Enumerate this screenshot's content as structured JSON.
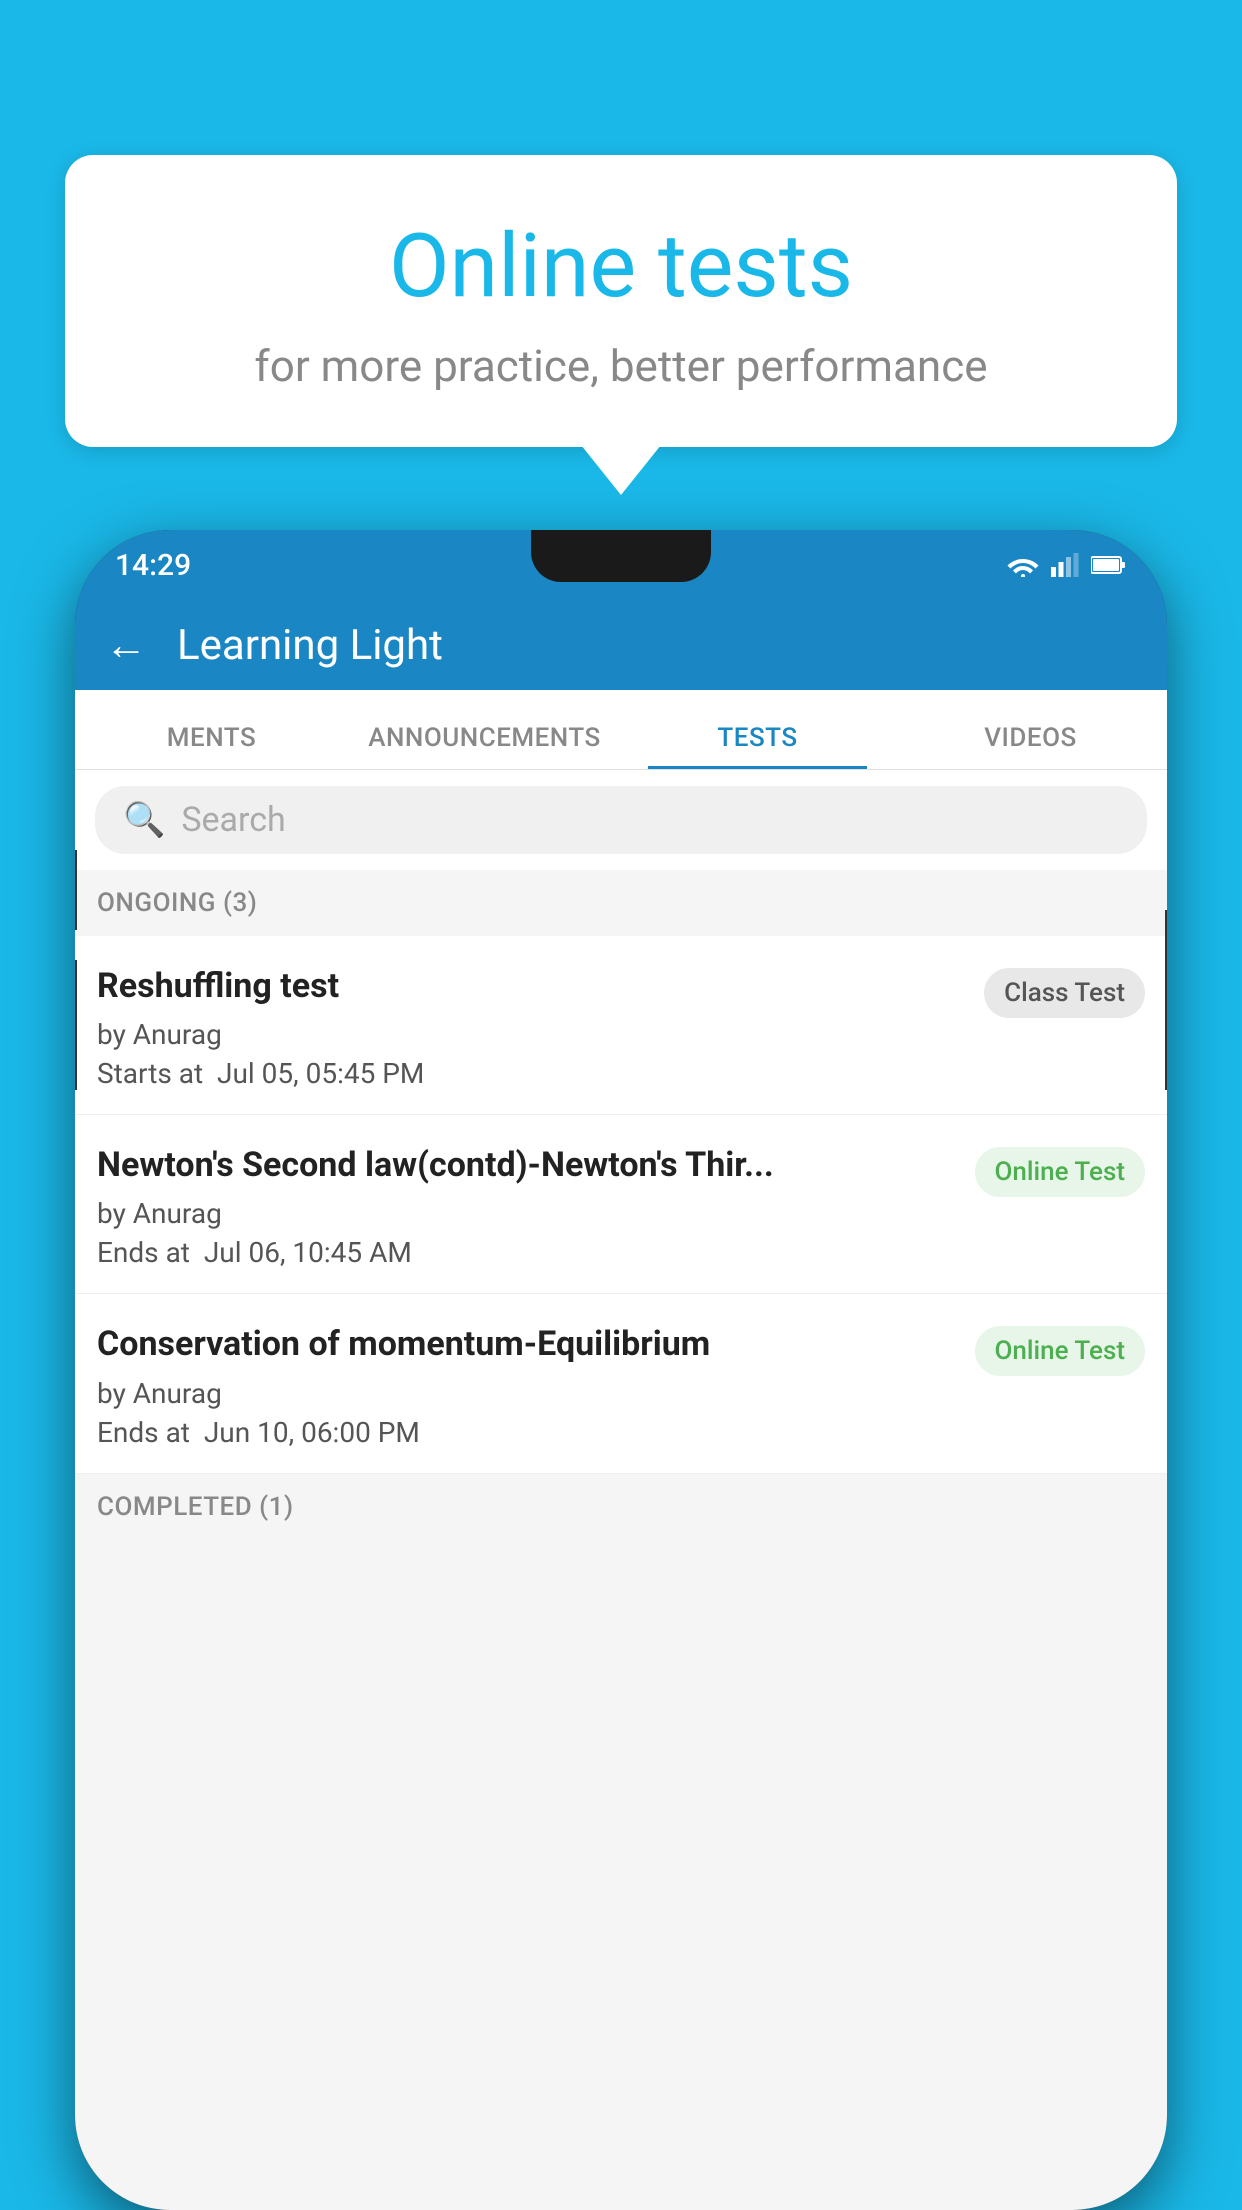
{
  "background": {
    "color": "#1ab8e8"
  },
  "speech_bubble": {
    "title": "Online tests",
    "subtitle": "for more practice, better performance"
  },
  "phone": {
    "status_bar": {
      "time": "14:29"
    },
    "header": {
      "title": "Learning Light",
      "back_label": "←"
    },
    "tabs": [
      {
        "label": "MENTS",
        "active": false
      },
      {
        "label": "ANNOUNCEMENTS",
        "active": false
      },
      {
        "label": "TESTS",
        "active": true
      },
      {
        "label": "VIDEOS",
        "active": false
      }
    ],
    "search": {
      "placeholder": "Search"
    },
    "sections": [
      {
        "header": "ONGOING (3)",
        "tests": [
          {
            "name": "Reshuffling test",
            "author": "by Anurag",
            "date_label": "Starts at",
            "date": "Jul 05, 05:45 PM",
            "badge": "Class Test",
            "badge_type": "class"
          },
          {
            "name": "Newton's Second law(contd)-Newton's Thir...",
            "author": "by Anurag",
            "date_label": "Ends at",
            "date": "Jul 06, 10:45 AM",
            "badge": "Online Test",
            "badge_type": "online"
          },
          {
            "name": "Conservation of momentum-Equilibrium",
            "author": "by Anurag",
            "date_label": "Ends at",
            "date": "Jun 10, 06:00 PM",
            "badge": "Online Test",
            "badge_type": "online"
          }
        ]
      }
    ],
    "completed_header": "COMPLETED (1)"
  }
}
